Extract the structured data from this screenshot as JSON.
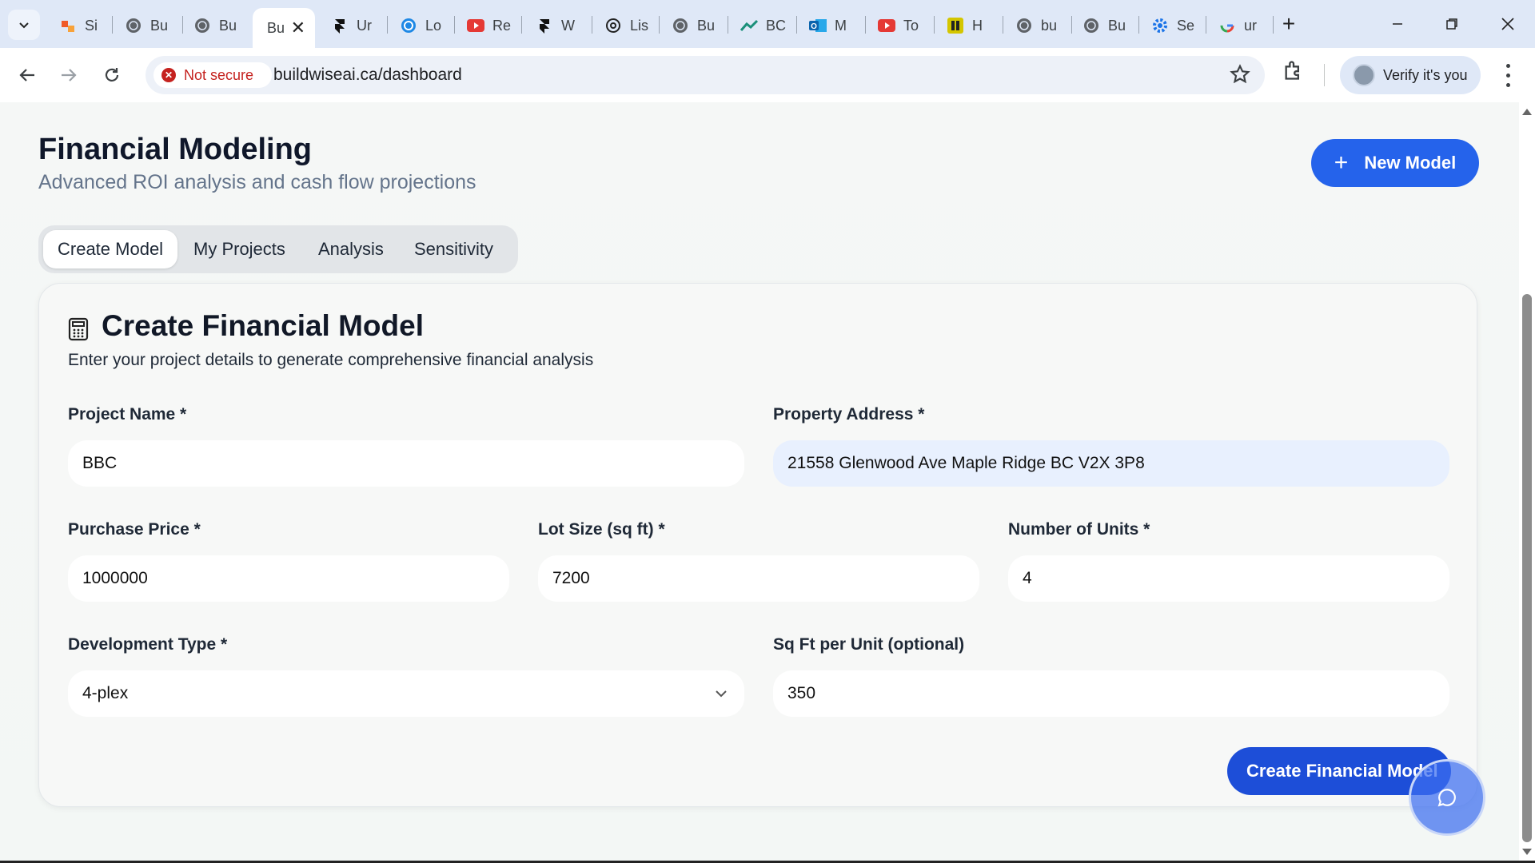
{
  "browser": {
    "tabs": [
      {
        "label": "Si",
        "icon": "orange-app-icon"
      },
      {
        "label": "Bu",
        "icon": "globe-icon"
      },
      {
        "label": "Bu",
        "icon": "globe-icon"
      },
      {
        "label": "Bu",
        "icon": "close-icon",
        "active": true
      },
      {
        "label": "Ur",
        "icon": "framer-icon"
      },
      {
        "label": "Lo",
        "icon": "blue-swirl-icon"
      },
      {
        "label": "Re",
        "icon": "youtube-icon"
      },
      {
        "label": "W",
        "icon": "framer-icon"
      },
      {
        "label": "Lis",
        "icon": "openai-icon"
      },
      {
        "label": "Bu",
        "icon": "globe-icon"
      },
      {
        "label": "BC",
        "icon": "chart-icon"
      },
      {
        "label": "M",
        "icon": "outlook-icon"
      },
      {
        "label": "To",
        "icon": "youtube-icon"
      },
      {
        "label": "H",
        "icon": "yellow-app-icon"
      },
      {
        "label": "bu",
        "icon": "globe-icon"
      },
      {
        "label": "Bu",
        "icon": "globe-icon"
      },
      {
        "label": "Se",
        "icon": "gear-icon"
      },
      {
        "label": "ur",
        "icon": "google-icon"
      }
    ],
    "security_label": "Not secure",
    "url": "buildwiseai.ca/dashboard",
    "profile_label": "Verify it's you"
  },
  "header": {
    "title": "Financial Modeling",
    "subtitle": "Advanced ROI analysis and cash flow projections",
    "new_model_label": "New Model"
  },
  "tabs": [
    {
      "label": "Create Model",
      "active": true
    },
    {
      "label": "My Projects"
    },
    {
      "label": "Analysis"
    },
    {
      "label": "Sensitivity"
    }
  ],
  "form": {
    "title": "Create Financial Model",
    "description": "Enter your project details to generate comprehensive financial analysis",
    "project_name": {
      "label": "Project Name *",
      "value": "BBC"
    },
    "property_address": {
      "label": "Property Address *",
      "value": "21558 Glenwood Ave Maple Ridge BC V2X 3P8"
    },
    "purchase_price": {
      "label": "Purchase Price *",
      "value": "1000000"
    },
    "lot_size": {
      "label": "Lot Size (sq ft) *",
      "value": "7200"
    },
    "units": {
      "label": "Number of Units *",
      "value": "4"
    },
    "development_type": {
      "label": "Development Type *",
      "value": "4-plex"
    },
    "sqft_per_unit": {
      "label": "Sq Ft per Unit (optional)",
      "value": "350"
    },
    "submit_label": "Create Financial Model"
  },
  "colors": {
    "primary": "#2563eb",
    "title": "#0f172a",
    "muted": "#64748b"
  }
}
